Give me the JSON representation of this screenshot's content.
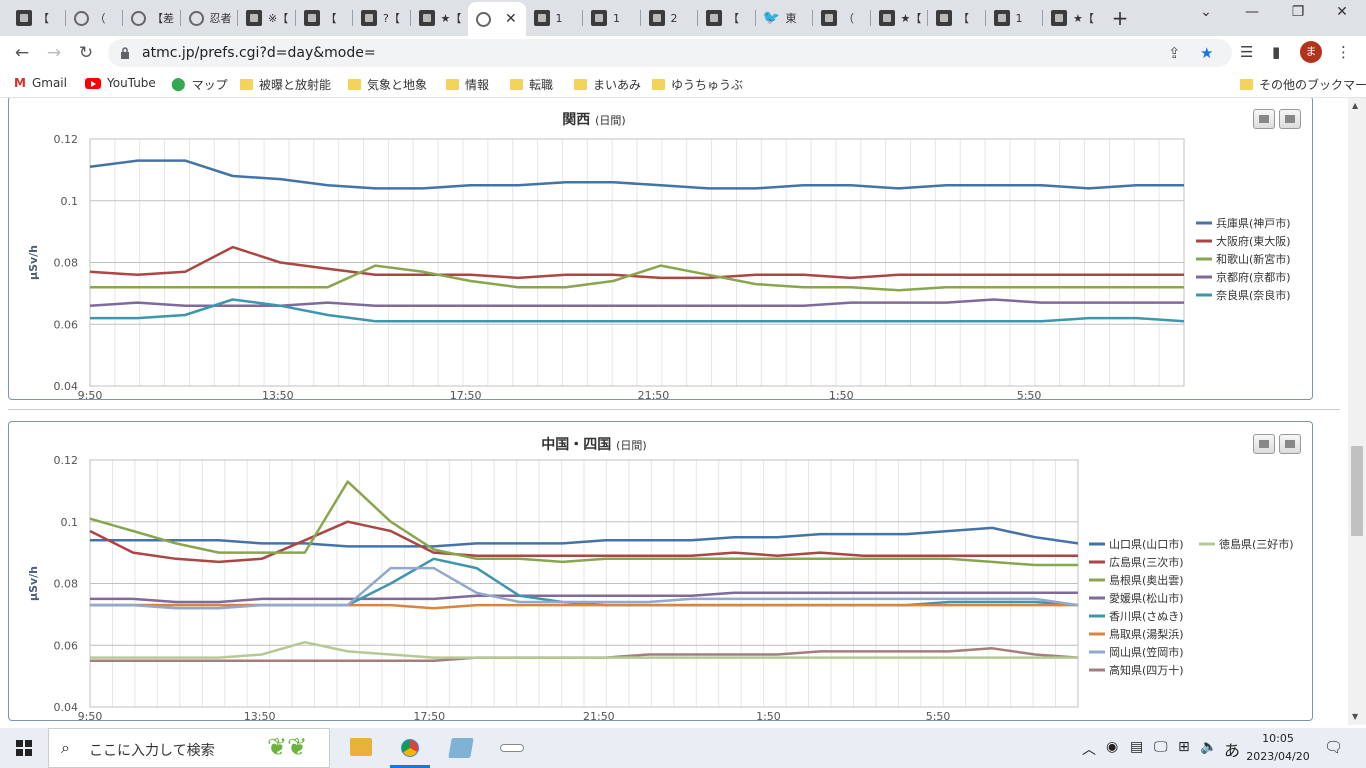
{
  "browser": {
    "tabs": [
      {
        "title": "【",
        "icon": "site-icon"
      },
      {
        "title": "（",
        "icon": "globe-icon"
      },
      {
        "title": "【差",
        "icon": "globe-icon"
      },
      {
        "title": "忍者",
        "icon": "globe-icon"
      },
      {
        "title": "※【",
        "icon": "site-icon"
      },
      {
        "title": "【",
        "icon": "site-icon"
      },
      {
        "title": "?【",
        "icon": "site-icon"
      },
      {
        "title": "★【",
        "icon": "site-icon"
      },
      {
        "title": "",
        "icon": "globe-icon",
        "active": true
      },
      {
        "title": "1",
        "icon": "site-icon"
      },
      {
        "title": "1",
        "icon": "site-icon"
      },
      {
        "title": "2",
        "icon": "site-icon"
      },
      {
        "title": "【",
        "icon": "site-icon"
      },
      {
        "title": "東",
        "icon": "bird-icon"
      },
      {
        "title": "（",
        "icon": "site-icon"
      },
      {
        "title": "★【",
        "icon": "site-icon"
      },
      {
        "title": "【",
        "icon": "site-icon"
      },
      {
        "title": "1",
        "icon": "site-icon"
      },
      {
        "title": "★【",
        "icon": "site-icon"
      }
    ],
    "url": "atmc.jp/prefs.cgi?d=day&mode=",
    "avatar_letter": "ま",
    "bookmarks": [
      "Gmail",
      "YouTube",
      "マップ",
      "被曝と放射能",
      "気象と地象",
      "情報",
      "転職",
      "まいあみ",
      "ゆうちゅうぶ"
    ],
    "other_bookmarks": "その他のブックマーク"
  },
  "taskbar": {
    "search_placeholder": "ここに入力して検索",
    "ime": "あ",
    "time": "10:05",
    "date": "2023/04/20"
  },
  "chart_data": [
    {
      "type": "line",
      "title": "関西",
      "subtitle": "(日間)",
      "ylabel": "μSv/h",
      "ylim": [
        0.04,
        0.12
      ],
      "yticks": [
        "0.04",
        "0.06",
        "0.08",
        "0.1",
        "0.12"
      ],
      "xticks": [
        "9:50",
        "13:50",
        "17:50",
        "21:50",
        "1:50",
        "5:50"
      ],
      "legend_position": "right",
      "x_points": 24,
      "series": [
        {
          "name": "兵庫県(神戸市)",
          "color": "#4572a7",
          "values": [
            0.111,
            0.113,
            0.113,
            0.108,
            0.107,
            0.105,
            0.104,
            0.104,
            0.105,
            0.105,
            0.106,
            0.106,
            0.105,
            0.104,
            0.104,
            0.105,
            0.105,
            0.104,
            0.105,
            0.105,
            0.105,
            0.104,
            0.105,
            0.105
          ]
        },
        {
          "name": "大阪府(東大阪)",
          "color": "#aa4643",
          "values": [
            0.077,
            0.076,
            0.077,
            0.085,
            0.08,
            0.078,
            0.076,
            0.076,
            0.076,
            0.075,
            0.076,
            0.076,
            0.075,
            0.075,
            0.076,
            0.076,
            0.075,
            0.076,
            0.076,
            0.076,
            0.076,
            0.076,
            0.076,
            0.076
          ]
        },
        {
          "name": "和歌山(新宮市)",
          "color": "#89a54e",
          "values": [
            0.072,
            0.072,
            0.072,
            0.072,
            0.072,
            0.072,
            0.079,
            0.077,
            0.074,
            0.072,
            0.072,
            0.074,
            0.079,
            0.076,
            0.073,
            0.072,
            0.072,
            0.071,
            0.072,
            0.072,
            0.072,
            0.072,
            0.072,
            0.072
          ]
        },
        {
          "name": "京都府(京都市)",
          "color": "#80699b",
          "values": [
            0.066,
            0.067,
            0.066,
            0.066,
            0.066,
            0.067,
            0.066,
            0.066,
            0.066,
            0.066,
            0.066,
            0.066,
            0.066,
            0.066,
            0.066,
            0.066,
            0.067,
            0.067,
            0.067,
            0.068,
            0.067,
            0.067,
            0.067,
            0.067
          ]
        },
        {
          "name": "奈良県(奈良市)",
          "color": "#3d96ae",
          "values": [
            0.062,
            0.062,
            0.063,
            0.068,
            0.066,
            0.063,
            0.061,
            0.061,
            0.061,
            0.061,
            0.061,
            0.061,
            0.061,
            0.061,
            0.061,
            0.061,
            0.061,
            0.061,
            0.061,
            0.061,
            0.061,
            0.062,
            0.062,
            0.061
          ]
        }
      ]
    },
    {
      "type": "line",
      "title": "中国・四国",
      "subtitle": "(日間)",
      "ylabel": "μSv/h",
      "ylim": [
        0.04,
        0.12
      ],
      "yticks": [
        "0.04",
        "0.06",
        "0.08",
        "0.1",
        "0.12"
      ],
      "xticks": [
        "9:50",
        "13:50",
        "17:50",
        "21:50",
        "1:50",
        "5:50"
      ],
      "legend_position": "right",
      "x_points": 24,
      "series": [
        {
          "name": "山口県(山口市)",
          "color": "#4572a7",
          "values": [
            0.094,
            0.094,
            0.094,
            0.094,
            0.093,
            0.093,
            0.092,
            0.092,
            0.092,
            0.093,
            0.093,
            0.093,
            0.094,
            0.094,
            0.094,
            0.095,
            0.095,
            0.096,
            0.096,
            0.096,
            0.097,
            0.098,
            0.095,
            0.093
          ]
        },
        {
          "name": "広島県(三次市)",
          "color": "#aa4643",
          "values": [
            0.097,
            0.09,
            0.088,
            0.087,
            0.088,
            0.094,
            0.1,
            0.097,
            0.09,
            0.089,
            0.089,
            0.089,
            0.089,
            0.089,
            0.089,
            0.09,
            0.089,
            0.09,
            0.089,
            0.089,
            0.089,
            0.089,
            0.089,
            0.089
          ]
        },
        {
          "name": "島根県(奥出雲)",
          "color": "#89a54e",
          "values": [
            0.101,
            0.097,
            0.093,
            0.09,
            0.09,
            0.09,
            0.113,
            0.1,
            0.091,
            0.088,
            0.088,
            0.087,
            0.088,
            0.088,
            0.088,
            0.088,
            0.088,
            0.088,
            0.088,
            0.088,
            0.088,
            0.087,
            0.086,
            0.086
          ]
        },
        {
          "name": "愛媛県(松山市)",
          "color": "#80699b",
          "values": [
            0.075,
            0.075,
            0.074,
            0.074,
            0.075,
            0.075,
            0.075,
            0.075,
            0.075,
            0.076,
            0.076,
            0.076,
            0.076,
            0.076,
            0.076,
            0.077,
            0.077,
            0.077,
            0.077,
            0.077,
            0.077,
            0.077,
            0.077,
            0.077
          ]
        },
        {
          "name": "香川県(さぬき)",
          "color": "#3d96ae",
          "values": [
            0.073,
            0.073,
            0.073,
            0.073,
            0.073,
            0.073,
            0.073,
            0.08,
            0.088,
            0.085,
            0.076,
            0.074,
            0.073,
            0.073,
            0.073,
            0.073,
            0.073,
            0.073,
            0.073,
            0.073,
            0.074,
            0.074,
            0.074,
            0.073
          ]
        },
        {
          "name": "鳥取県(湯梨浜)",
          "color": "#db843d",
          "values": [
            0.073,
            0.073,
            0.073,
            0.073,
            0.073,
            0.073,
            0.073,
            0.073,
            0.072,
            0.073,
            0.073,
            0.073,
            0.073,
            0.073,
            0.073,
            0.073,
            0.073,
            0.073,
            0.073,
            0.073,
            0.073,
            0.073,
            0.073,
            0.073
          ]
        },
        {
          "name": "岡山県(笠岡市)",
          "color": "#92a8cd",
          "values": [
            0.073,
            0.073,
            0.072,
            0.072,
            0.073,
            0.073,
            0.073,
            0.085,
            0.085,
            0.077,
            0.074,
            0.074,
            0.074,
            0.074,
            0.075,
            0.075,
            0.075,
            0.075,
            0.075,
            0.075,
            0.075,
            0.075,
            0.075,
            0.073
          ]
        },
        {
          "name": "高知県(四万十)",
          "color": "#a47d7c",
          "values": [
            0.055,
            0.055,
            0.055,
            0.055,
            0.055,
            0.055,
            0.055,
            0.055,
            0.055,
            0.056,
            0.056,
            0.056,
            0.056,
            0.057,
            0.057,
            0.057,
            0.057,
            0.058,
            0.058,
            0.058,
            0.058,
            0.059,
            0.057,
            0.056
          ]
        },
        {
          "name": "徳島県(三好市)",
          "color": "#b5ca92",
          "values": [
            0.056,
            0.056,
            0.056,
            0.056,
            0.057,
            0.061,
            0.058,
            0.057,
            0.056,
            0.056,
            0.056,
            0.056,
            0.056,
            0.056,
            0.056,
            0.056,
            0.056,
            0.056,
            0.056,
            0.056,
            0.056,
            0.056,
            0.056,
            0.056
          ]
        }
      ]
    }
  ]
}
